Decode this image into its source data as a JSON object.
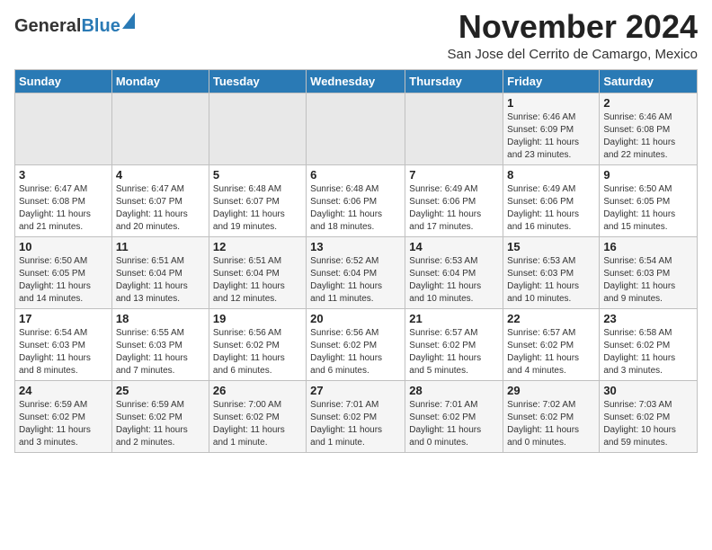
{
  "header": {
    "logo_line1": "General",
    "logo_line2": "Blue",
    "month_title": "November 2024",
    "location": "San Jose del Cerrito de Camargo, Mexico"
  },
  "weekdays": [
    "Sunday",
    "Monday",
    "Tuesday",
    "Wednesday",
    "Thursday",
    "Friday",
    "Saturday"
  ],
  "weeks": [
    [
      {
        "day": "",
        "info": ""
      },
      {
        "day": "",
        "info": ""
      },
      {
        "day": "",
        "info": ""
      },
      {
        "day": "",
        "info": ""
      },
      {
        "day": "",
        "info": ""
      },
      {
        "day": "1",
        "info": "Sunrise: 6:46 AM\nSunset: 6:09 PM\nDaylight: 11 hours\nand 23 minutes."
      },
      {
        "day": "2",
        "info": "Sunrise: 6:46 AM\nSunset: 6:08 PM\nDaylight: 11 hours\nand 22 minutes."
      }
    ],
    [
      {
        "day": "3",
        "info": "Sunrise: 6:47 AM\nSunset: 6:08 PM\nDaylight: 11 hours\nand 21 minutes."
      },
      {
        "day": "4",
        "info": "Sunrise: 6:47 AM\nSunset: 6:07 PM\nDaylight: 11 hours\nand 20 minutes."
      },
      {
        "day": "5",
        "info": "Sunrise: 6:48 AM\nSunset: 6:07 PM\nDaylight: 11 hours\nand 19 minutes."
      },
      {
        "day": "6",
        "info": "Sunrise: 6:48 AM\nSunset: 6:06 PM\nDaylight: 11 hours\nand 18 minutes."
      },
      {
        "day": "7",
        "info": "Sunrise: 6:49 AM\nSunset: 6:06 PM\nDaylight: 11 hours\nand 17 minutes."
      },
      {
        "day": "8",
        "info": "Sunrise: 6:49 AM\nSunset: 6:06 PM\nDaylight: 11 hours\nand 16 minutes."
      },
      {
        "day": "9",
        "info": "Sunrise: 6:50 AM\nSunset: 6:05 PM\nDaylight: 11 hours\nand 15 minutes."
      }
    ],
    [
      {
        "day": "10",
        "info": "Sunrise: 6:50 AM\nSunset: 6:05 PM\nDaylight: 11 hours\nand 14 minutes."
      },
      {
        "day": "11",
        "info": "Sunrise: 6:51 AM\nSunset: 6:04 PM\nDaylight: 11 hours\nand 13 minutes."
      },
      {
        "day": "12",
        "info": "Sunrise: 6:51 AM\nSunset: 6:04 PM\nDaylight: 11 hours\nand 12 minutes."
      },
      {
        "day": "13",
        "info": "Sunrise: 6:52 AM\nSunset: 6:04 PM\nDaylight: 11 hours\nand 11 minutes."
      },
      {
        "day": "14",
        "info": "Sunrise: 6:53 AM\nSunset: 6:04 PM\nDaylight: 11 hours\nand 10 minutes."
      },
      {
        "day": "15",
        "info": "Sunrise: 6:53 AM\nSunset: 6:03 PM\nDaylight: 11 hours\nand 10 minutes."
      },
      {
        "day": "16",
        "info": "Sunrise: 6:54 AM\nSunset: 6:03 PM\nDaylight: 11 hours\nand 9 minutes."
      }
    ],
    [
      {
        "day": "17",
        "info": "Sunrise: 6:54 AM\nSunset: 6:03 PM\nDaylight: 11 hours\nand 8 minutes."
      },
      {
        "day": "18",
        "info": "Sunrise: 6:55 AM\nSunset: 6:03 PM\nDaylight: 11 hours\nand 7 minutes."
      },
      {
        "day": "19",
        "info": "Sunrise: 6:56 AM\nSunset: 6:02 PM\nDaylight: 11 hours\nand 6 minutes."
      },
      {
        "day": "20",
        "info": "Sunrise: 6:56 AM\nSunset: 6:02 PM\nDaylight: 11 hours\nand 6 minutes."
      },
      {
        "day": "21",
        "info": "Sunrise: 6:57 AM\nSunset: 6:02 PM\nDaylight: 11 hours\nand 5 minutes."
      },
      {
        "day": "22",
        "info": "Sunrise: 6:57 AM\nSunset: 6:02 PM\nDaylight: 11 hours\nand 4 minutes."
      },
      {
        "day": "23",
        "info": "Sunrise: 6:58 AM\nSunset: 6:02 PM\nDaylight: 11 hours\nand 3 minutes."
      }
    ],
    [
      {
        "day": "24",
        "info": "Sunrise: 6:59 AM\nSunset: 6:02 PM\nDaylight: 11 hours\nand 3 minutes."
      },
      {
        "day": "25",
        "info": "Sunrise: 6:59 AM\nSunset: 6:02 PM\nDaylight: 11 hours\nand 2 minutes."
      },
      {
        "day": "26",
        "info": "Sunrise: 7:00 AM\nSunset: 6:02 PM\nDaylight: 11 hours\nand 1 minute."
      },
      {
        "day": "27",
        "info": "Sunrise: 7:01 AM\nSunset: 6:02 PM\nDaylight: 11 hours\nand 1 minute."
      },
      {
        "day": "28",
        "info": "Sunrise: 7:01 AM\nSunset: 6:02 PM\nDaylight: 11 hours\nand 0 minutes."
      },
      {
        "day": "29",
        "info": "Sunrise: 7:02 AM\nSunset: 6:02 PM\nDaylight: 11 hours\nand 0 minutes."
      },
      {
        "day": "30",
        "info": "Sunrise: 7:03 AM\nSunset: 6:02 PM\nDaylight: 10 hours\nand 59 minutes."
      }
    ]
  ]
}
